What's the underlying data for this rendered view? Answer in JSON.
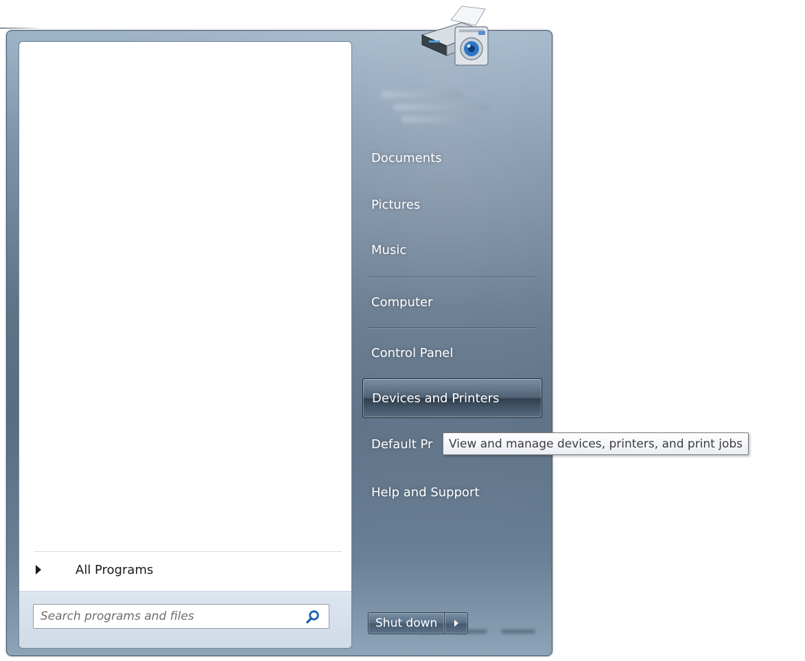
{
  "left_pane": {
    "all_programs_label": "All Programs",
    "search": {
      "placeholder": "Search programs and files"
    }
  },
  "right_pane": {
    "items": [
      {
        "label": "Documents"
      },
      {
        "label": "Pictures"
      },
      {
        "label": "Music"
      },
      {
        "label": "Computer"
      },
      {
        "label": "Control Panel"
      },
      {
        "label": "Devices and Printers"
      },
      {
        "label": "Default Pr"
      },
      {
        "label": "Help and Support"
      }
    ],
    "hovered_item": "Devices and Printers",
    "shutdown_label": "Shut down"
  },
  "tooltip": {
    "text": "View and manage devices, printers, and print jobs"
  },
  "icons": {
    "search": "search-icon",
    "printer": "printer-camera-icon",
    "all_programs_arrow": "arrow-right-icon",
    "shutdown_options": "arrow-right-icon"
  },
  "colors": {
    "menu_blue": "#5e7288",
    "text_white": "#ffffff",
    "search_band": "#dde6ef"
  }
}
